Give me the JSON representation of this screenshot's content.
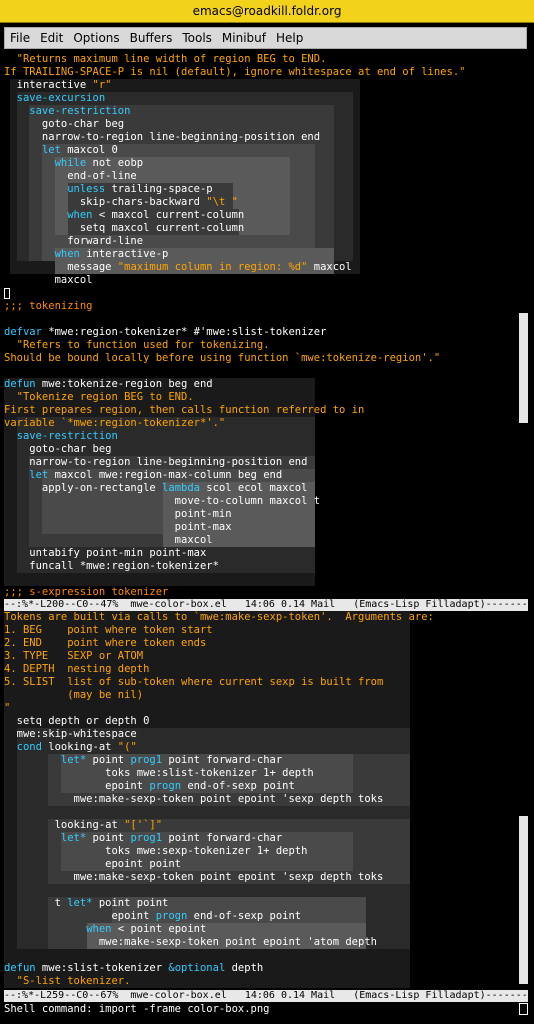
{
  "window": {
    "title": "emacs@roadkill.foldr.org"
  },
  "menu": [
    "File",
    "Edit",
    "Options",
    "Buffers",
    "Tools",
    "Minibuf",
    "Help"
  ],
  "colors": {
    "keyword": "#33ccff",
    "string": "#ffa500",
    "comment": "#ff8c00",
    "text": "#ffffff",
    "title_bg": "#f2d21b",
    "modeline_bg": "#e8e8e8",
    "box_levels": [
      "#1a1a1a",
      "#2a2a2a",
      "#3a3a3a",
      "#4a4a4a",
      "#5a5a5a"
    ]
  },
  "pane1": {
    "lines": [
      [
        {
          "t": "  \"Returns maximum line width of region BEG to END.",
          "c": "s"
        }
      ],
      [
        {
          "t": "If TRAILING-SPACE-P is nil (default), ignore whitespace at end of lines.\"",
          "c": "s"
        }
      ],
      [
        {
          "t": "  interactive ",
          "c": "n"
        },
        {
          "t": "\"r\"",
          "c": "s"
        }
      ],
      [
        {
          "t": "  save-excursion",
          "c": "k"
        }
      ],
      [
        {
          "t": "    save-restriction",
          "c": "k"
        }
      ],
      [
        {
          "t": "      goto-char beg",
          "c": "n"
        }
      ],
      [
        {
          "t": "      narrow-to-region line-beginning-position end",
          "c": "n"
        }
      ],
      [
        {
          "t": "      ",
          "c": "n"
        },
        {
          "t": "let",
          "c": "k"
        },
        {
          "t": " maxcol 0",
          "c": "n"
        }
      ],
      [
        {
          "t": "        ",
          "c": "n"
        },
        {
          "t": "while",
          "c": "k"
        },
        {
          "t": " not eobp",
          "c": "n"
        }
      ],
      [
        {
          "t": "          end-of-line",
          "c": "n"
        }
      ],
      [
        {
          "t": "          ",
          "c": "n"
        },
        {
          "t": "unless",
          "c": "k"
        },
        {
          "t": " trailing-space-p",
          "c": "n"
        }
      ],
      [
        {
          "t": "            skip-chars-backward ",
          "c": "n"
        },
        {
          "t": "\"\\t \"",
          "c": "s"
        }
      ],
      [
        {
          "t": "          ",
          "c": "n"
        },
        {
          "t": "when",
          "c": "k"
        },
        {
          "t": " < maxcol current-column",
          "c": "n"
        }
      ],
      [
        {
          "t": "            setq maxcol current-column",
          "c": "n"
        }
      ],
      [
        {
          "t": "          forward-line",
          "c": "n"
        }
      ],
      [
        {
          "t": "        ",
          "c": "n"
        },
        {
          "t": "when",
          "c": "k"
        },
        {
          "t": " interactive-p",
          "c": "n"
        }
      ],
      [
        {
          "t": "          message ",
          "c": "n"
        },
        {
          "t": "\"maximum column in region: %d\"",
          "c": "s"
        },
        {
          "t": " maxcol",
          "c": "n"
        }
      ],
      [
        {
          "t": "        maxcol",
          "c": "n"
        }
      ],
      [
        {
          "t": "",
          "c": "n"
        }
      ],
      [
        {
          "t": ";;; tokenizing",
          "c": "c"
        }
      ],
      [
        {
          "t": "",
          "c": "n"
        }
      ],
      [
        {
          "t": "defvar",
          "c": "k"
        },
        {
          "t": " *mwe:region-tokenizer* #'mwe:slist-tokenizer",
          "c": "n"
        }
      ],
      [
        {
          "t": "  \"Refers to function used for tokenizing.",
          "c": "s"
        }
      ],
      [
        {
          "t": "Should be bound locally before using function `mwe:tokenize-region'.\"",
          "c": "s"
        }
      ],
      [
        {
          "t": "",
          "c": "n"
        }
      ],
      [
        {
          "t": "defun",
          "c": "k"
        },
        {
          "t": " mwe:tokenize-region beg end",
          "c": "n"
        }
      ],
      [
        {
          "t": "  \"Tokenize region BEG to END.",
          "c": "s"
        }
      ],
      [
        {
          "t": "First prepares region, then calls function referred to in",
          "c": "s"
        }
      ],
      [
        {
          "t": "variable `*mwe:region-tokenizer*'.\"",
          "c": "s"
        }
      ],
      [
        {
          "t": "  save-restriction",
          "c": "k"
        }
      ],
      [
        {
          "t": "    goto-char beg",
          "c": "n"
        }
      ],
      [
        {
          "t": "    narrow-to-region line-beginning-position end",
          "c": "n"
        }
      ],
      [
        {
          "t": "    ",
          "c": "n"
        },
        {
          "t": "let",
          "c": "k"
        },
        {
          "t": " maxcol mwe:region-max-column beg end",
          "c": "n"
        }
      ],
      [
        {
          "t": "      apply-on-rectangle ",
          "c": "n"
        },
        {
          "t": "lambda",
          "c": "k"
        },
        {
          "t": " scol ecol maxcol",
          "c": "n"
        }
      ],
      [
        {
          "t": "                           move-to-column maxcol t",
          "c": "n"
        }
      ],
      [
        {
          "t": "                           point-min",
          "c": "n"
        }
      ],
      [
        {
          "t": "                           point-max",
          "c": "n"
        }
      ],
      [
        {
          "t": "                           maxcol",
          "c": "n"
        }
      ],
      [
        {
          "t": "    untabify point-min point-max",
          "c": "n"
        }
      ],
      [
        {
          "t": "    funcall *mwe:region-tokenizer*",
          "c": "n"
        }
      ],
      [
        {
          "t": "",
          "c": "n"
        }
      ],
      [
        {
          "t": ";;; s-expression tokenizer",
          "c": "c"
        }
      ]
    ]
  },
  "modeline1": "--:%*-L200--C0--47%  mwe-color-box.el   14:06 0.14 Mail   (Emacs-Lisp Filladapt)-------",
  "pane2": {
    "lines": [
      [
        {
          "t": "Tokens are built via calls to `mwe:make-sexp-token'.  Arguments are:",
          "c": "s"
        }
      ],
      [
        {
          "t": "1. BEG    point where token start",
          "c": "s"
        }
      ],
      [
        {
          "t": "2. END    point where token ends",
          "c": "s"
        }
      ],
      [
        {
          "t": "3. TYPE   SEXP or ATOM",
          "c": "s"
        }
      ],
      [
        {
          "t": "4. DEPTH  nesting depth",
          "c": "s"
        }
      ],
      [
        {
          "t": "5. SLIST  list of sub-token where current sexp is built from",
          "c": "s"
        }
      ],
      [
        {
          "t": "          (may be nil)",
          "c": "s"
        }
      ],
      [
        {
          "t": "\"",
          "c": "s"
        }
      ],
      [
        {
          "t": "  setq depth or depth 0",
          "c": "n"
        }
      ],
      [
        {
          "t": "  mwe:skip-whitespace",
          "c": "n"
        }
      ],
      [
        {
          "t": "  cond",
          "c": "k"
        },
        {
          "t": " looking-at ",
          "c": "n"
        },
        {
          "t": "\"(\"",
          "c": "s"
        }
      ],
      [
        {
          "t": "         ",
          "c": "n"
        },
        {
          "t": "let*",
          "c": "k"
        },
        {
          "t": " point ",
          "c": "n"
        },
        {
          "t": "prog1",
          "c": "k"
        },
        {
          "t": " point forward-char",
          "c": "n"
        }
      ],
      [
        {
          "t": "                toks mwe:slist-tokenizer 1+ depth",
          "c": "n"
        }
      ],
      [
        {
          "t": "                epoint ",
          "c": "n"
        },
        {
          "t": "progn",
          "c": "k"
        },
        {
          "t": " end-of-sexp point",
          "c": "n"
        }
      ],
      [
        {
          "t": "           mwe:make-sexp-token point epoint 'sexp depth toks",
          "c": "n"
        }
      ],
      [
        {
          "t": "",
          "c": "n"
        }
      ],
      [
        {
          "t": "        looking-at ",
          "c": "n"
        },
        {
          "t": "\"['`]\"",
          "c": "s"
        }
      ],
      [
        {
          "t": "         ",
          "c": "n"
        },
        {
          "t": "let*",
          "c": "k"
        },
        {
          "t": " point ",
          "c": "n"
        },
        {
          "t": "prog1",
          "c": "k"
        },
        {
          "t": " point forward-char",
          "c": "n"
        }
      ],
      [
        {
          "t": "                toks mwe:sexp-tokenizer 1+ depth",
          "c": "n"
        }
      ],
      [
        {
          "t": "                epoint point",
          "c": "n"
        }
      ],
      [
        {
          "t": "           mwe:make-sexp-token point epoint 'sexp depth toks",
          "c": "n"
        }
      ],
      [
        {
          "t": "",
          "c": "n"
        }
      ],
      [
        {
          "t": "        t ",
          "c": "n"
        },
        {
          "t": "let*",
          "c": "k"
        },
        {
          "t": " point point",
          "c": "n"
        }
      ],
      [
        {
          "t": "                 epoint ",
          "c": "n"
        },
        {
          "t": "progn",
          "c": "k"
        },
        {
          "t": " end-of-sexp point",
          "c": "n"
        }
      ],
      [
        {
          "t": "             ",
          "c": "n"
        },
        {
          "t": "when",
          "c": "k"
        },
        {
          "t": " < point epoint",
          "c": "n"
        }
      ],
      [
        {
          "t": "               mwe:make-sexp-token point epoint 'atom depth",
          "c": "n"
        }
      ],
      [
        {
          "t": "",
          "c": "n"
        }
      ],
      [
        {
          "t": "defun",
          "c": "k"
        },
        {
          "t": " mwe:slist-tokenizer ",
          "c": "n"
        },
        {
          "t": "&optional",
          "c": "k"
        },
        {
          "t": " depth",
          "c": "n"
        }
      ],
      [
        {
          "t": "  \"S-list tokenizer.",
          "c": "s"
        }
      ]
    ]
  },
  "modeline2": "--:%*-L259--C0--67%  mwe-color-box.el   14:06 0.14 Mail   (Emacs-Lisp Filladapt)-------",
  "minibuffer": "Shell command: import -frame color-box.png"
}
